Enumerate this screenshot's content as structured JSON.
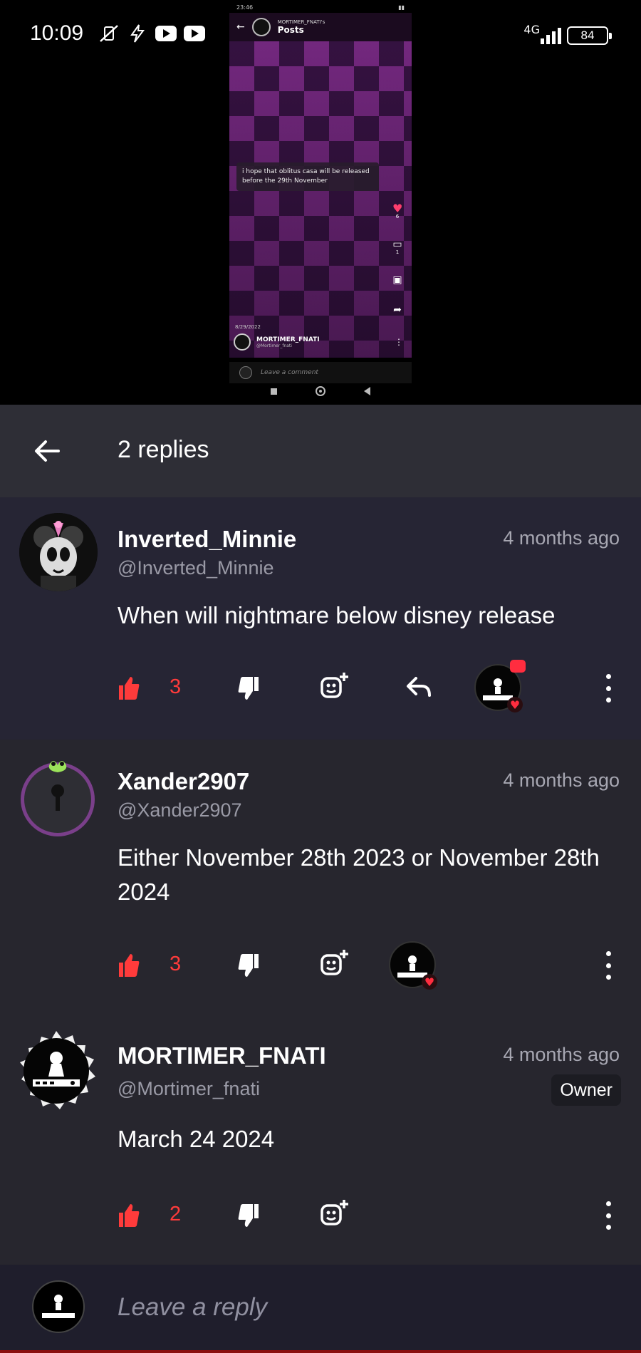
{
  "status_bar": {
    "time": "10:09",
    "network": "4G",
    "battery": "84"
  },
  "video": {
    "status_time": "23:46",
    "header_owner": "MORTIMER_FNATI's",
    "header_title": "Posts",
    "caption": "i hope that oblitus casa will be released before the 29th November",
    "likes": "6",
    "comments": "1",
    "date": "8/29/2022",
    "author_name": "MORTIMER_FNATI",
    "author_handle": "@Mortimer_fnati",
    "comment_placeholder": "Leave a comment"
  },
  "replies": {
    "title": "2 replies",
    "comments": [
      {
        "name": "Inverted_Minnie",
        "handle": "@Inverted_Minnie",
        "time": "4 months ago",
        "text": "When will nightmare below disney release",
        "likes": "3"
      },
      {
        "name": "Xander2907",
        "handle": "@Xander2907",
        "time": "4 months ago",
        "text": "Either November 28th 2023 or November 28th 2024",
        "likes": "3"
      },
      {
        "name": "MORTIMER_FNATI",
        "handle": "@Mortimer_fnati",
        "time": "4 months ago",
        "badge": "Owner",
        "text": "March 24 2024",
        "likes": "2"
      }
    ],
    "reply_placeholder": "Leave a reply"
  },
  "colors": {
    "accent": "#ff3b3b",
    "sheet_bg": "#27262e",
    "header_bg": "#2e2e36"
  }
}
